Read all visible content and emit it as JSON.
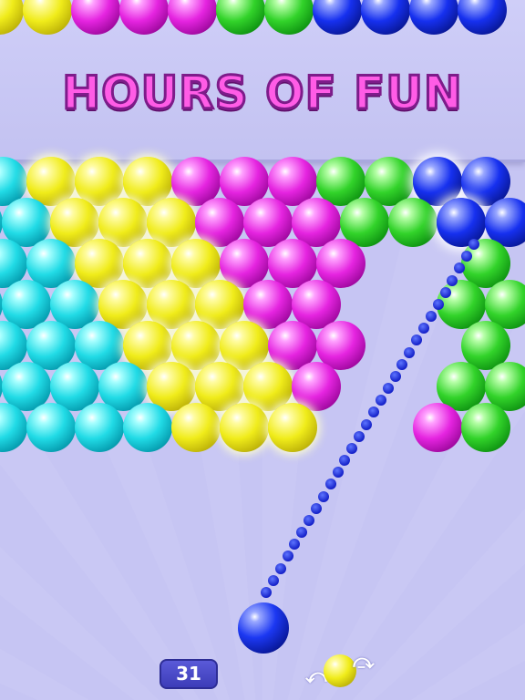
{
  "banner": {
    "title": "HOURS OF FUN"
  },
  "hud": {
    "moves_left": "31",
    "next_bubble_color": "yellow",
    "shooter_color": "blue"
  },
  "colors": {
    "background": "#c6c5f3",
    "title_fill": "#ff5ce6",
    "title_outline": "#7d1c8a",
    "aim_dots": "#1420c8",
    "moves_badge": "#4747c6"
  },
  "icons": {
    "swap": "swap-arrows-icon"
  },
  "top_strip": [
    "yellow",
    "yellow",
    "magenta",
    "magenta",
    "magenta",
    "green",
    "green",
    "blue",
    "blue",
    "blue",
    "blue"
  ],
  "grid": [
    [
      "cyan",
      "yellow*",
      "yellow*",
      "yellow*",
      "magenta",
      "magenta",
      "magenta",
      "green",
      "green",
      "blue*",
      "blue"
    ],
    [
      "cyan",
      "cyan",
      "yellow*",
      "yellow*",
      "yellow*",
      "magenta",
      "magenta",
      "magenta",
      "green",
      "green",
      "blue*",
      "blue"
    ],
    [
      "cyan",
      "cyan",
      "yellow*",
      "yellow*",
      "yellow*",
      "magenta",
      "magenta",
      "magenta",
      null,
      null,
      "green"
    ],
    [
      "cyan",
      "cyan",
      "cyan",
      "yellow*",
      "yellow*",
      "yellow*",
      "magenta",
      "magenta",
      null,
      null,
      "green",
      "green"
    ],
    [
      "cyan",
      "cyan",
      "cyan",
      "yellow*",
      "yellow*",
      "yellow*",
      "magenta",
      "magenta",
      null,
      null,
      "green"
    ],
    [
      "cyan",
      "cyan",
      "cyan",
      "cyan",
      "yellow*",
      "yellow*",
      "yellow*",
      "magenta",
      null,
      null,
      "green",
      "green"
    ],
    [
      "cyan",
      "cyan",
      "cyan",
      "cyan",
      "yellow",
      "yellow*",
      "yellow*",
      null,
      null,
      "magenta",
      "green"
    ]
  ]
}
